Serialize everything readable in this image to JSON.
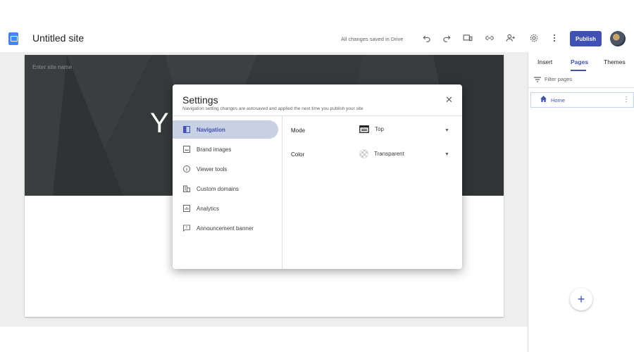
{
  "header": {
    "title": "Untitled site",
    "save_status": "All changes saved in Drive",
    "publish_label": "Publish",
    "icons": [
      "undo-icon",
      "redo-icon",
      "preview-icon",
      "link-icon",
      "share-icon",
      "settings-icon",
      "more-vert-icon"
    ]
  },
  "hero": {
    "site_name_placeholder": "Enter site name",
    "title_partial": "Y"
  },
  "sidebar": {
    "tabs": [
      {
        "label": "Insert"
      },
      {
        "label": "Pages",
        "active": true
      },
      {
        "label": "Themes"
      }
    ],
    "filter_placeholder": "Filter pages",
    "pages": [
      {
        "label": "Home"
      }
    ]
  },
  "settings": {
    "title": "Settings",
    "subtitle": "Navigation setting changes are autosaved and applied the next time you publish your site",
    "close_label": "✕",
    "nav": [
      {
        "label": "Navigation",
        "icon": "navigation-icon",
        "active": true
      },
      {
        "label": "Brand images",
        "icon": "image-icon"
      },
      {
        "label": "Viewer tools",
        "icon": "info-icon"
      },
      {
        "label": "Custom domains",
        "icon": "domain-icon"
      },
      {
        "label": "Analytics",
        "icon": "analytics-icon"
      },
      {
        "label": "Announcement banner",
        "icon": "announcement-icon"
      }
    ],
    "fields": [
      {
        "label": "Mode",
        "value": "Top"
      },
      {
        "label": "Color",
        "value": "Transparent"
      }
    ]
  },
  "colors": {
    "accent": "#3f51b5",
    "hero_bg": "#36393a",
    "nav_active_bg": "#c8d0e4"
  }
}
